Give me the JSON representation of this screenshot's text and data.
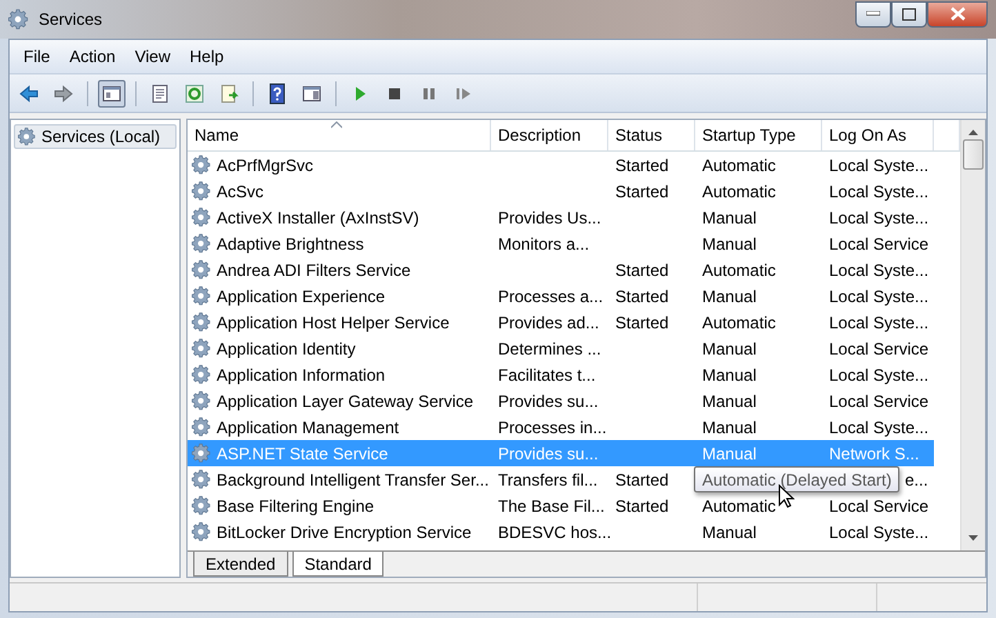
{
  "window": {
    "title": "Services"
  },
  "menu": [
    "File",
    "Action",
    "View",
    "Help"
  ],
  "tree": [
    {
      "label": "Services (Local)",
      "selected": true
    }
  ],
  "table": {
    "columns": [
      "Name",
      "Description",
      "Status",
      "Startup Type",
      "Log On As"
    ],
    "rows": [
      {
        "name": "AcPrfMgrSvc",
        "status": "Started",
        "startup": "Automatic",
        "log_on": "Local Syste...",
        "selected": false
      },
      {
        "name": "AcSvc",
        "status": "Started",
        "startup": "Automatic",
        "log_on": "Local Syste...",
        "selected": false
      },
      {
        "name": "ActiveX Installer (AxInstSV)",
        "description": "Provides Us...",
        "startup": "Manual",
        "log_on": "Local Syste...",
        "selected": false
      },
      {
        "name": "Adaptive Brightness",
        "description": "Monitors a...",
        "startup": "Manual",
        "log_on": "Local Service",
        "selected": false
      },
      {
        "name": "Andrea ADI Filters Service",
        "status": "Started",
        "startup": "Automatic",
        "log_on": "Local Syste...",
        "selected": false
      },
      {
        "name": "Application Experience",
        "description": "Processes a...",
        "status": "Started",
        "startup": "Manual",
        "log_on": "Local Syste...",
        "selected": false
      },
      {
        "name": "Application Host Helper Service",
        "description": "Provides ad...",
        "status": "Started",
        "startup": "Automatic",
        "log_on": "Local Syste...",
        "selected": false
      },
      {
        "name": "Application Identity",
        "description": "Determines ...",
        "startup": "Manual",
        "log_on": "Local Service",
        "selected": false
      },
      {
        "name": "Application Information",
        "description": "Facilitates t...",
        "startup": "Manual",
        "log_on": "Local Syste...",
        "selected": false
      },
      {
        "name": "Application Layer Gateway Service",
        "description": "Provides su...",
        "startup": "Manual",
        "log_on": "Local Service",
        "selected": false
      },
      {
        "name": "Application Management",
        "description": "Processes in...",
        "startup": "Manual",
        "log_on": "Local Syste...",
        "selected": false
      },
      {
        "name": "ASP.NET State Service",
        "description": "Provides su...",
        "startup": "Manual",
        "log_on": "Network S...",
        "selected": true
      },
      {
        "name": "Background Intelligent Transfer Ser...",
        "description": "Transfers fil...",
        "status": "Started",
        "tooltip": "Automatic (Delayed Start)",
        "log_on": "e...",
        "selected": false
      },
      {
        "name": "Base Filtering Engine",
        "description": "The Base Fil...",
        "status": "Started",
        "startup": "Automatic",
        "log_on": "Local Service",
        "selected": false
      },
      {
        "name": "BitLocker Drive Encryption Service",
        "description": "BDESVC hos...",
        "startup": "Manual",
        "log_on": "Local Syste...",
        "selected": false
      }
    ]
  },
  "view_tabs": [
    {
      "label": "Extended",
      "selected": false
    },
    {
      "label": "Standard",
      "selected": true
    }
  ]
}
